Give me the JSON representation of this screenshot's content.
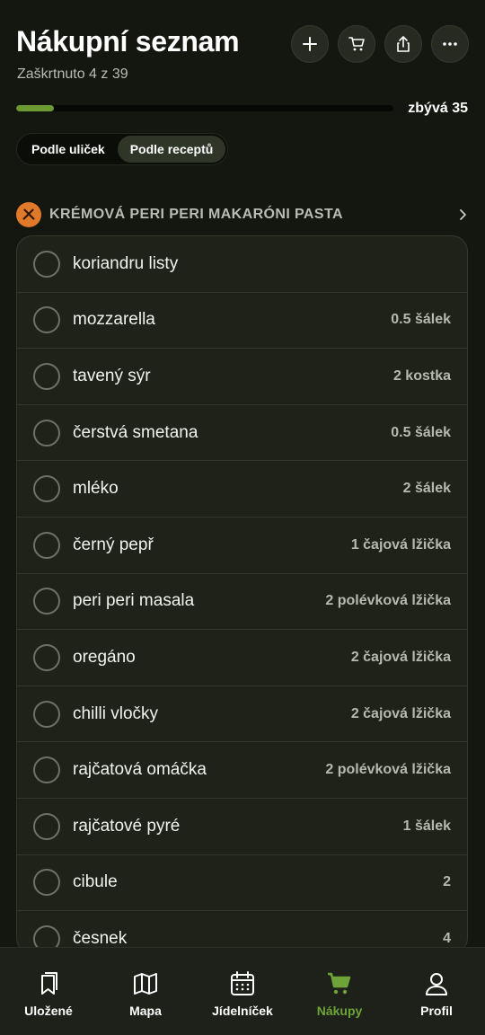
{
  "header": {
    "title": "Nákupní seznam",
    "subtitle": "Zaškrtnuto 4 z 39",
    "buttons": [
      {
        "icon": "plus-icon"
      },
      {
        "icon": "cart-icon"
      },
      {
        "icon": "share-icon"
      },
      {
        "icon": "more-icon"
      }
    ]
  },
  "progress": {
    "checked": 4,
    "total": 39,
    "fraction": 0.1,
    "remaining_label": "zbývá 35"
  },
  "view_toggle": {
    "options": [
      "Podle uliček",
      "Podle receptů"
    ],
    "selected": "Podle receptů"
  },
  "recipe": {
    "title": "KRÉMOVÁ PERI PERI MAKARÓNI PASTA",
    "icon": "utensils-icon",
    "icon_color": "#e07a2a"
  },
  "items": [
    {
      "name": "koriandru listy",
      "qty": ""
    },
    {
      "name": "mozzarella",
      "qty": "0.5 šálek"
    },
    {
      "name": "tavený sýr",
      "qty": "2 kostka"
    },
    {
      "name": "čerstvá smetana",
      "qty": "0.5 šálek"
    },
    {
      "name": "mléko",
      "qty": "2 šálek"
    },
    {
      "name": "černý pepř",
      "qty": "1 čajová lžička"
    },
    {
      "name": "peri peri masala",
      "qty": "2 polévková lžička"
    },
    {
      "name": "oregáno",
      "qty": "2 čajová lžička"
    },
    {
      "name": "chilli vločky",
      "qty": "2 čajová lžička"
    },
    {
      "name": "rajčatová omáčka",
      "qty": "2 polévková lžička"
    },
    {
      "name": "rajčatové pyré",
      "qty": "1 šálek"
    },
    {
      "name": "cibule",
      "qty": "2"
    },
    {
      "name": "česnek",
      "qty": "4"
    }
  ],
  "tabs": [
    {
      "label": "Uložené",
      "icon": "bookmarks-icon"
    },
    {
      "label": "Mapa",
      "icon": "map-icon"
    },
    {
      "label": "Jídelníček",
      "icon": "calendar-icon"
    },
    {
      "label": "Nákupy",
      "icon": "cart-icon",
      "active": true
    },
    {
      "label": "Profil",
      "icon": "profile-icon"
    }
  ],
  "colors": {
    "accent": "#6ea33a",
    "background": "#14170f",
    "card": "#1e2219"
  }
}
